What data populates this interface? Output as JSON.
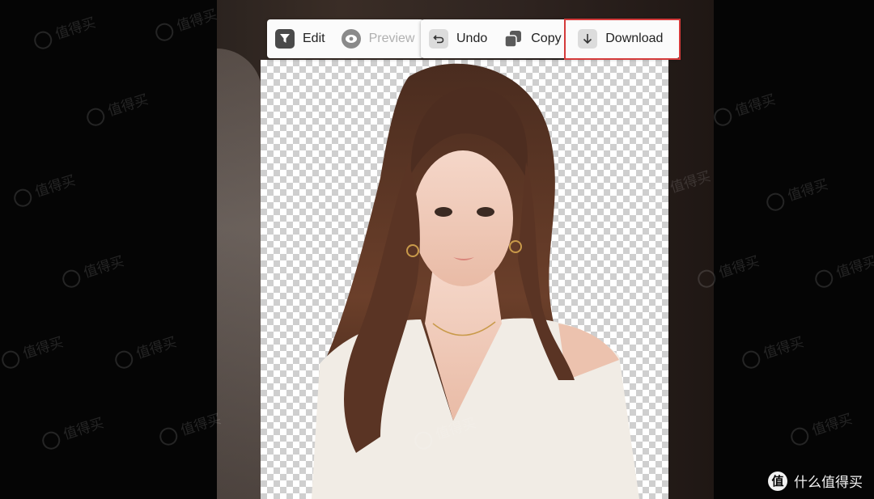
{
  "toolbar": {
    "edit": {
      "label": "Edit",
      "icon": "funnel-icon"
    },
    "preview": {
      "label": "Preview",
      "icon": "eye-icon",
      "disabled": true
    },
    "undo": {
      "label": "Undo",
      "icon": "undo-arrow-icon"
    },
    "copy": {
      "label": "Copy",
      "icon": "copy-icon"
    },
    "download": {
      "label": "Download",
      "icon": "download-arrow-icon",
      "highlighted": true
    }
  },
  "highlight_color": "#d43a3a",
  "watermark_text": "值得买",
  "brand": {
    "logo": "值",
    "text": "什么值得买"
  }
}
